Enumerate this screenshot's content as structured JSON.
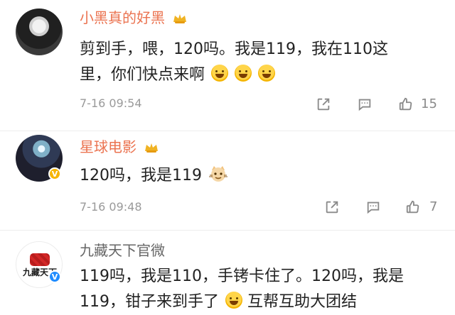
{
  "comments": [
    {
      "username": "小黑真的好黑",
      "text_line1": "剪到手，喂，120吗。我是119，我在110这",
      "text_line2": "里，你们快点来啊",
      "time": "7-16 09:54",
      "likes": "15",
      "name_color": "#eb7350"
    },
    {
      "username": "星球电影",
      "text_line1": "120吗，我是119",
      "time": "7-16 09:48",
      "likes": "7",
      "name_color": "#eb7350"
    },
    {
      "username": "九藏天下官微",
      "avatar_text": "九藏天下",
      "text_line1": "119吗，我是110，手铐卡住了。120吗，我是",
      "text_line2": "119，钳子来到手了",
      "text_line2_suffix": "互帮互助大团结",
      "name_color": "#666666"
    }
  ],
  "icons": {
    "share": "share-icon",
    "comment": "comment-icon",
    "like": "thumb-up-icon",
    "vip": "crown-icon",
    "verified": "verified-badge-icon"
  }
}
